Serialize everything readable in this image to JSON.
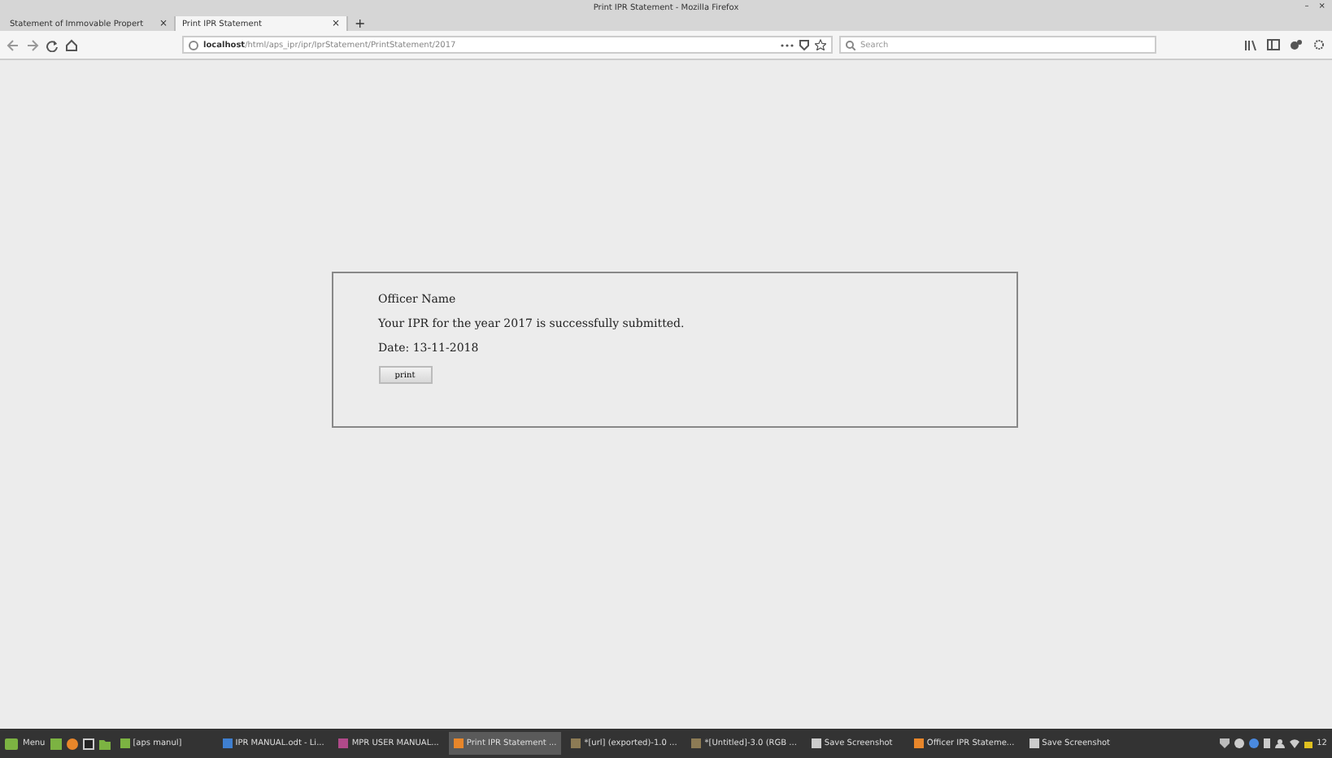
{
  "window": {
    "title": "Print IPR Statement - Mozilla Firefox",
    "minimize": "–",
    "close": "×"
  },
  "tabs": [
    {
      "label": "Statement of Immovable Propert",
      "close": "×",
      "selected": false
    },
    {
      "label": "Print IPR Statement",
      "close": "×",
      "selected": true
    }
  ],
  "new_tab": "+",
  "address_bar": {
    "host": "localhost",
    "path": "/html/aps_ipr/ipr/IprStatement/PrintStatement/2017"
  },
  "search": {
    "placeholder": "Search"
  },
  "card": {
    "officer": "Officer Name",
    "message": "Your IPR for the year 2017 is successfully submitted.",
    "date": "Date: 13-11-2018",
    "button": "print"
  },
  "taskbar": {
    "menu": "Menu",
    "items": [
      {
        "label": "[aps manul]",
        "selected": false,
        "kind": "folder"
      },
      {
        "label": "IPR MANUAL.odt - Li...",
        "selected": false,
        "kind": "doc"
      },
      {
        "label": "MPR USER MANUAL...",
        "selected": false,
        "kind": "pdf"
      },
      {
        "label": "Print IPR Statement ...",
        "selected": true,
        "kind": "browser"
      },
      {
        "label": "*[url] (exported)-1.0 ...",
        "selected": false,
        "kind": "gimp"
      },
      {
        "label": "*[Untitled]-3.0 (RGB ...",
        "selected": false,
        "kind": "gimp"
      },
      {
        "label": "Save Screenshot",
        "selected": false,
        "kind": "shot"
      },
      {
        "label": "Officer IPR Stateme...",
        "selected": false,
        "kind": "browser"
      },
      {
        "label": "Save Screenshot",
        "selected": false,
        "kind": "shot"
      }
    ],
    "clock": "12"
  }
}
